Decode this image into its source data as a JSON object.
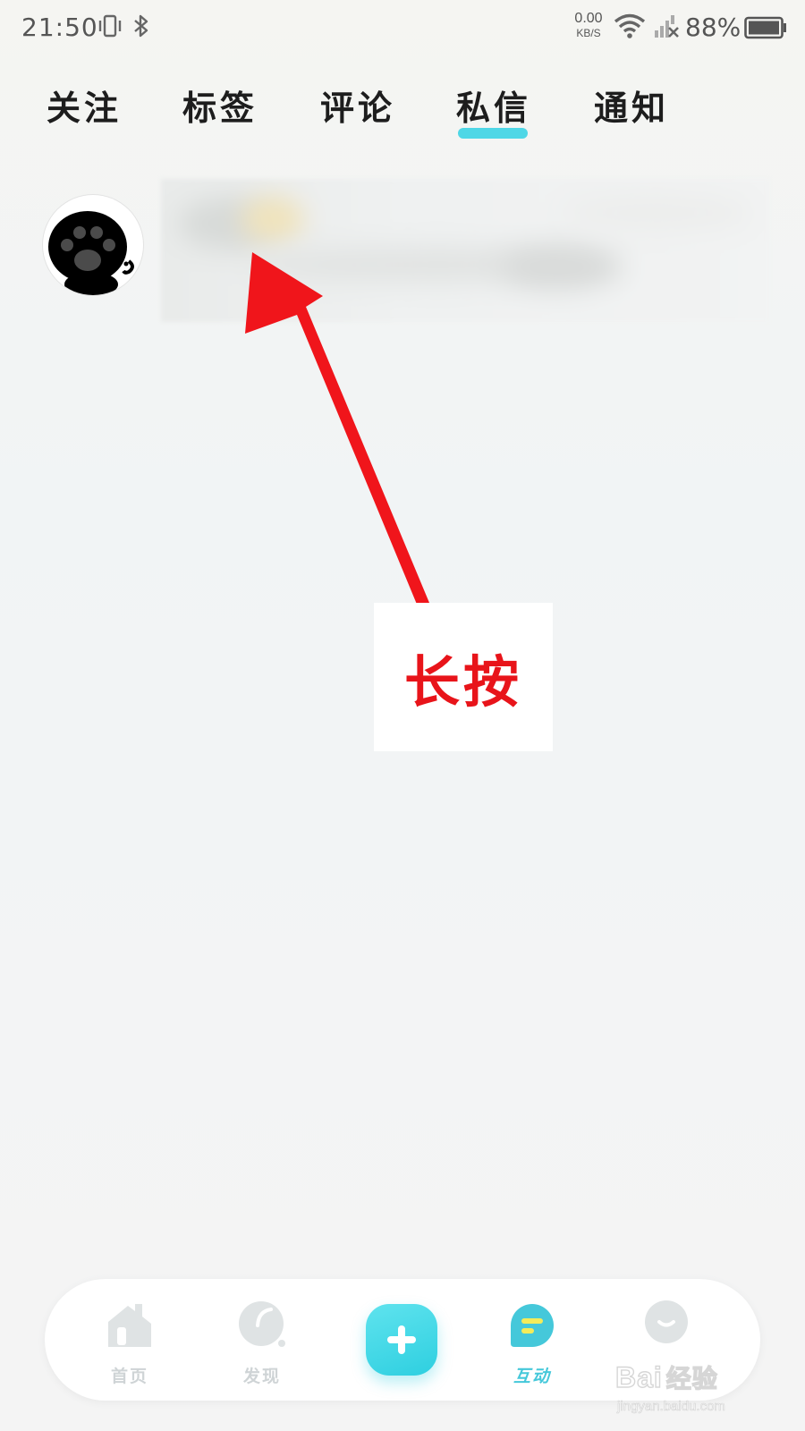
{
  "status_bar": {
    "time": "21:50",
    "net_speed_value": "0.00",
    "net_speed_unit": "KB/S",
    "battery": "88%",
    "icons": [
      "vibrate-icon",
      "bluetooth-icon",
      "wifi-icon",
      "signal-icon",
      "battery-icon"
    ]
  },
  "tabs": [
    {
      "label": "关注",
      "active": false
    },
    {
      "label": "标签",
      "active": false
    },
    {
      "label": "评论",
      "active": false
    },
    {
      "label": "私信",
      "active": true
    },
    {
      "label": "通知",
      "active": false
    }
  ],
  "accent_color": "#4fd7e6",
  "annotation": {
    "text": "长按",
    "color": "#e8141a"
  },
  "bottom_nav": {
    "items": [
      {
        "label": "首页",
        "icon": "home-icon",
        "active": false
      },
      {
        "label": "发现",
        "icon": "discover-icon",
        "active": false
      },
      {
        "label": "",
        "icon": "plus-icon",
        "active": false
      },
      {
        "label": "互动",
        "icon": "interaction-icon",
        "active": true
      },
      {
        "label": "",
        "icon": "profile-icon",
        "active": false
      }
    ]
  },
  "watermark": {
    "logo": "Bai",
    "logo_cn": "经验",
    "url": "jingyan.baidu.com"
  }
}
